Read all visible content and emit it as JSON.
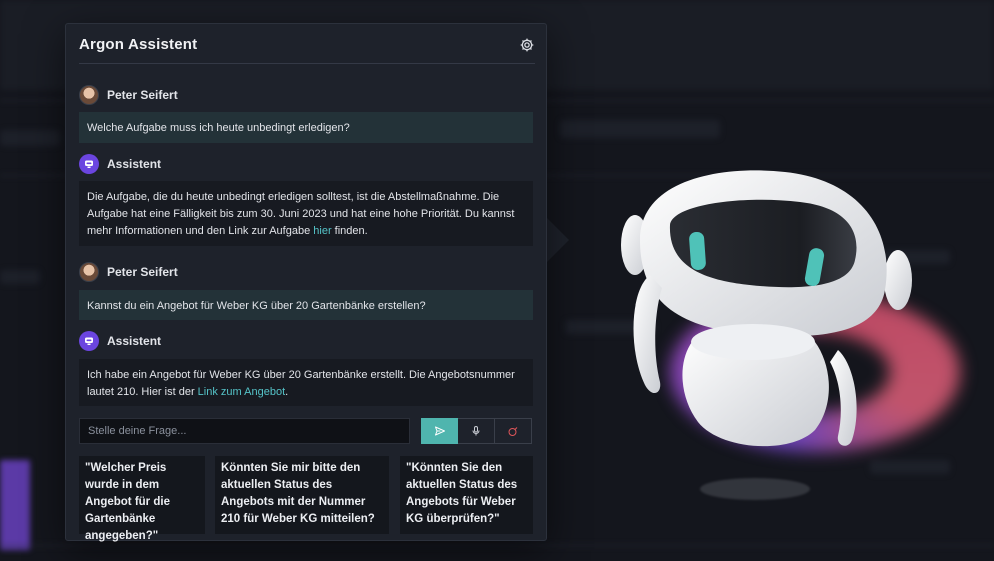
{
  "panel": {
    "title": "Argon Assistent"
  },
  "messages": [
    {
      "sender": "Peter Seifert",
      "role": "user",
      "text": "Welche Aufgabe muss ich heute unbedingt erledigen?"
    },
    {
      "sender": "Assistent",
      "role": "bot",
      "text_before": "Die Aufgabe, die du heute unbedingt erledigen solltest, ist die Abstellmaßnahme. Die Aufgabe hat eine Fälligkeit bis zum 30. Juni 2023 und hat eine hohe Priorität. Du kannst mehr Informationen und den Link zur Aufgabe ",
      "link": "hier",
      "text_after": " finden."
    },
    {
      "sender": "Peter Seifert",
      "role": "user",
      "text": "Kannst du ein Angebot für Weber KG über 20 Gartenbänke erstellen?"
    },
    {
      "sender": "Assistent",
      "role": "bot",
      "text_before": "Ich habe ein Angebot für Weber KG über 20 Gartenbänke erstellt. Die Angebotsnummer lautet 210. Hier ist der ",
      "link": "Link zum Angebot",
      "text_after": "."
    }
  ],
  "input": {
    "placeholder": "Stelle deine Frage..."
  },
  "suggestions": [
    "\"Welcher Preis wurde in dem Angebot für die Gartenbänke angegeben?\"",
    "Könnten Sie mir bitte den aktuellen Status des Angebots mit der Nummer 210 für Weber KG mitteilen?",
    "\"Könnten Sie den aktuellen Status des Angebots für Weber KG überprüfen?\""
  ],
  "colors": {
    "accent": "#4fb5ae",
    "link": "#55c3c8",
    "bot_avatar": "#6b45e0",
    "clear_icon": "#e0565a",
    "robot_eyes": "#4fc2b8"
  }
}
